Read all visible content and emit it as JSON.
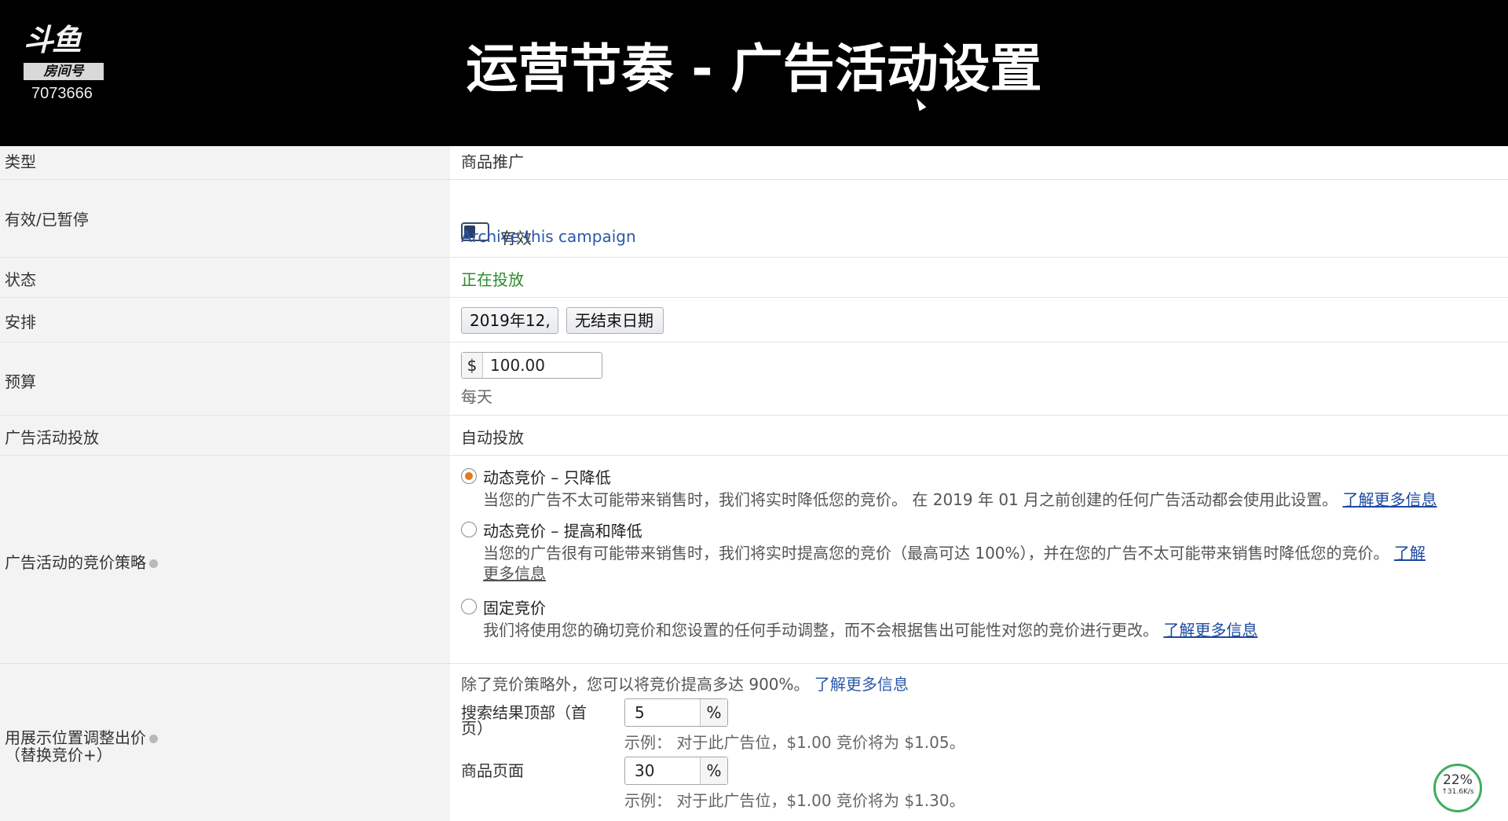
{
  "banner": {
    "logo_top": "斗鱼",
    "logo_box": "房间号",
    "room_number": "7073666",
    "title": "运营节奏 - 广告活动设置"
  },
  "rows": {
    "type": {
      "label": "类型",
      "value": "商品推广"
    },
    "active": {
      "label": "有效/已暂停",
      "toggle_text": "有效",
      "archive_link": "Archive this campaign"
    },
    "status": {
      "label": "状态",
      "value": "正在投放"
    },
    "schedule": {
      "label": "安排",
      "start_date": "2019年12,",
      "end_date": "无结束日期"
    },
    "budget": {
      "label": "预算",
      "currency": "$",
      "amount": "100.00",
      "period": "每天"
    },
    "targeting": {
      "label": "广告活动投放",
      "value": "自动投放"
    },
    "bidding": {
      "label": "广告活动的竞价策略",
      "options": [
        {
          "title": "动态竞价 – 只降低",
          "desc": "当您的广告不太可能带来销售时，我们将实时降低您的竞价。 在 2019 年 01 月之前创建的任何广告活动都会使用此设置。",
          "link": "了解更多信息",
          "selected": true
        },
        {
          "title": "动态竞价 – 提高和降低",
          "desc": "当您的广告很有可能带来销售时，我们将实时提高您的竞价（最高可达 100%），并在您的广告不太可能带来销售时降低您的竞价。",
          "link_part1": "了解",
          "link_part2": "更多信息",
          "selected": false
        },
        {
          "title": "固定竞价",
          "desc": "我们将使用您的确切竞价和您设置的任何手动调整，而不会根据售出可能性对您的竞价进行更改。",
          "link": "了解更多信息",
          "selected": false
        }
      ]
    },
    "placement": {
      "label_line1": "用展示位置调整出价",
      "label_line2": "（替换竞价+）",
      "intro": "除了竞价策略外，您可以将竞价提高多达 900%。",
      "intro_link": "了解更多信息",
      "top_label_line1": "搜索结果顶部（首",
      "top_label_line2": "页）",
      "top_value": "5",
      "top_unit": "%",
      "top_example": "示例： 对于此广告位，$1.00 竞价将为 $1.05。",
      "product_label": "商品页面",
      "product_value": "30",
      "product_unit": "%",
      "product_example": "示例： 对于此广告位，$1.00 竞价将为 $1.30。"
    }
  },
  "overlay": {
    "percent": "22%",
    "speed": "↑31.6K/s"
  }
}
